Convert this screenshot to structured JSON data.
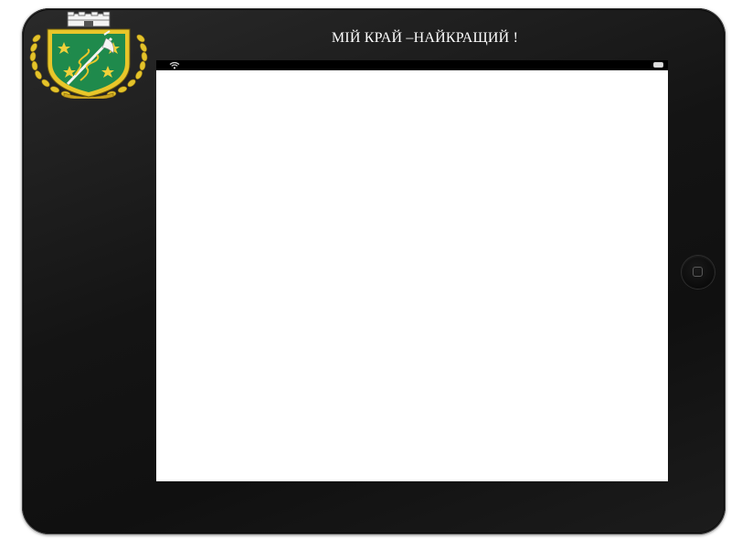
{
  "tablet": {
    "title": "МІЙ КРАЙ –НАЙКРАЩИЙ !"
  },
  "emblem": {
    "icon": "coat-of-arms-icon",
    "colors": {
      "shield": "#1f8a4c",
      "gold": "#e8c62a",
      "crown": "#f2f2f2"
    }
  },
  "status_bar": {
    "wifi_icon": "wifi-icon",
    "battery_icon": "battery-icon"
  },
  "home_button": {
    "icon": "home-square-icon"
  }
}
